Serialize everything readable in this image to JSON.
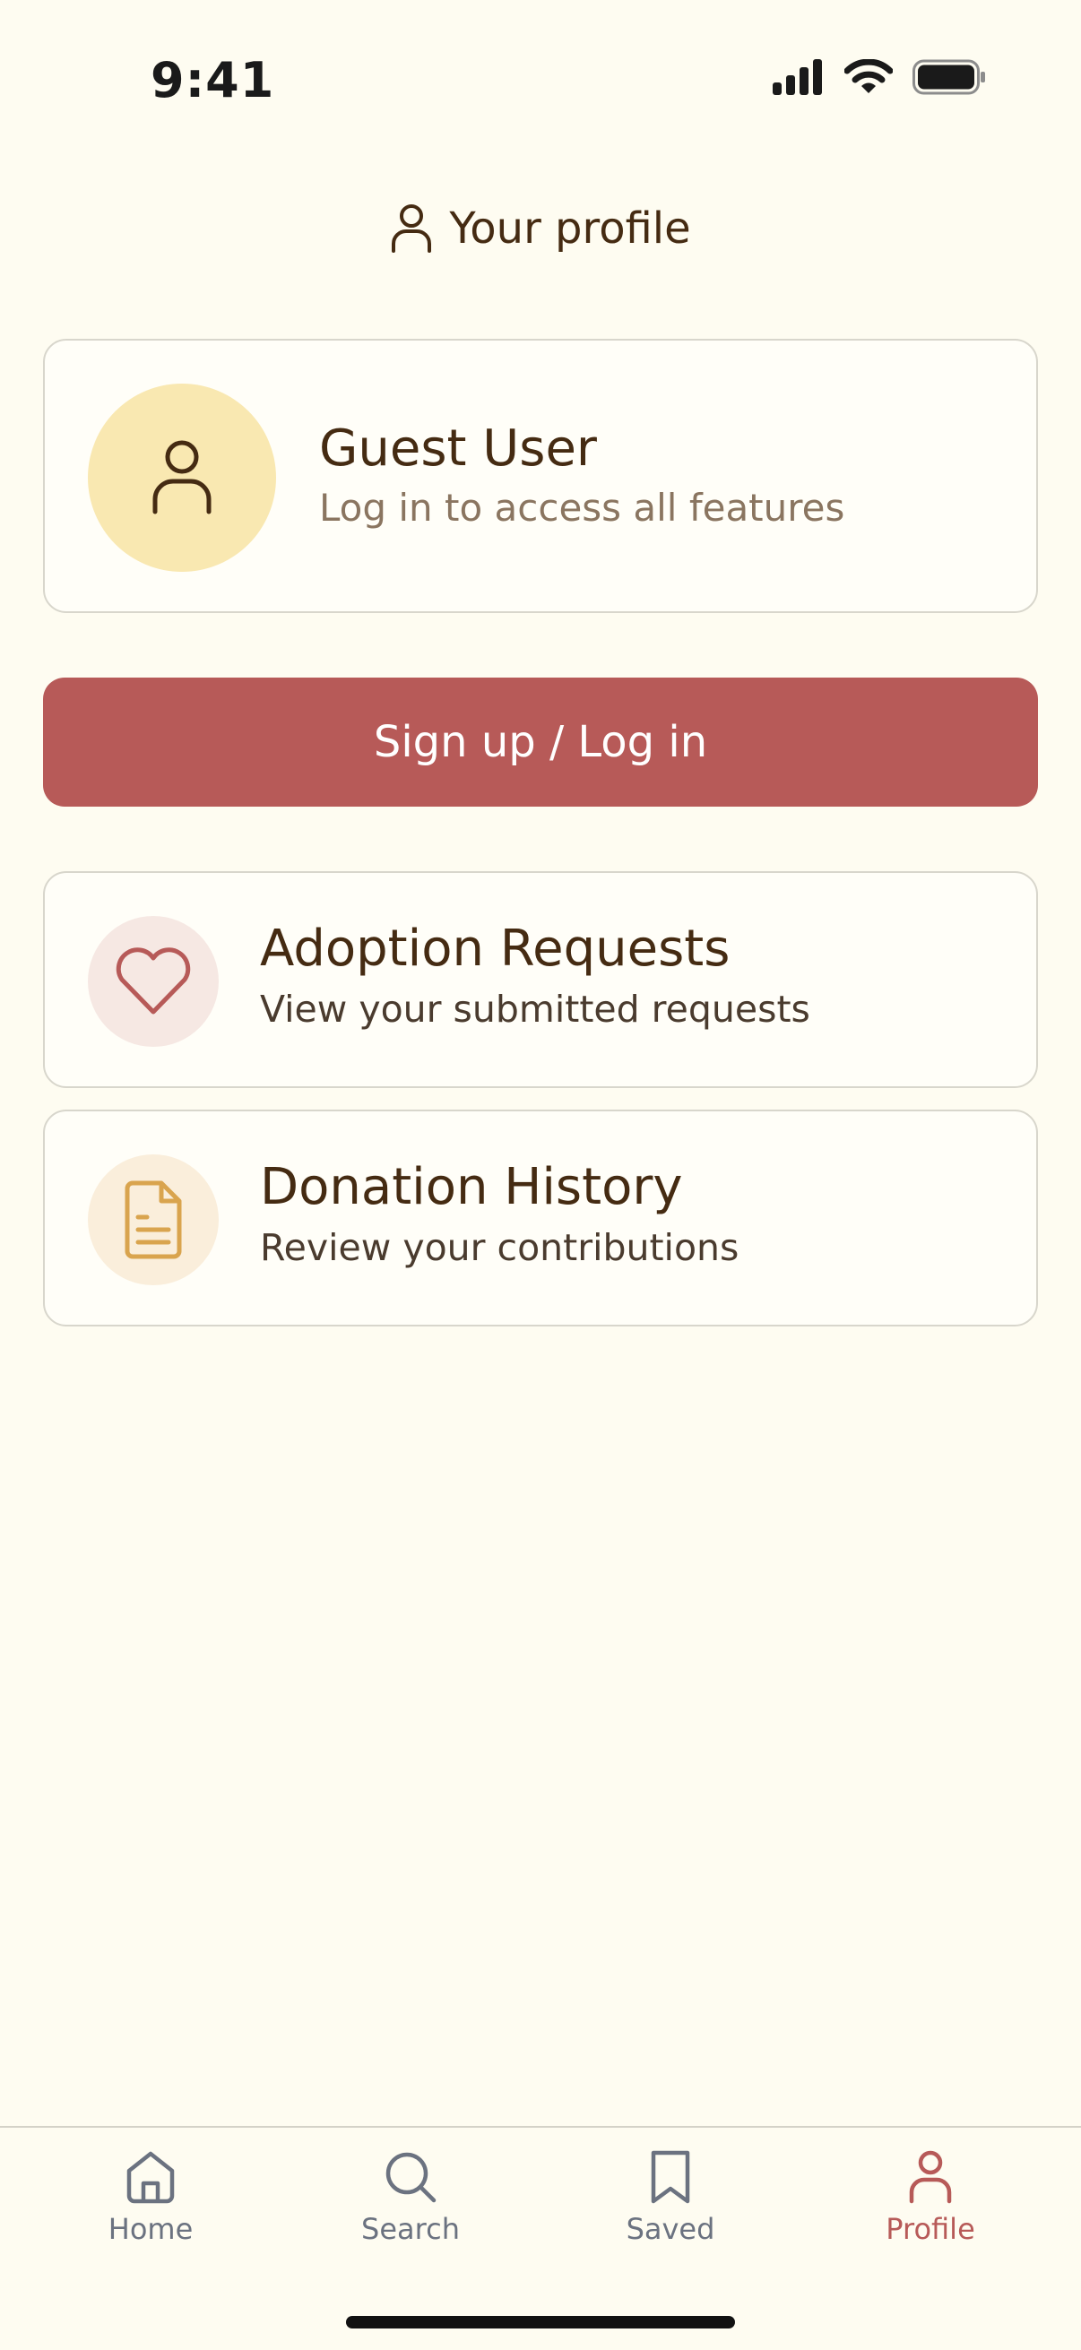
{
  "status_bar": {
    "time": "9:41"
  },
  "header": {
    "title": "Your profile",
    "icon": "user-icon"
  },
  "profile_card": {
    "name": "Guest User",
    "subtitle": "Log in to access all features",
    "avatar_icon": "user-icon"
  },
  "signin_button": {
    "label": "Sign up / Log in"
  },
  "menu": [
    {
      "title": "Adoption Requests",
      "subtitle": "View your submitted requests",
      "icon": "heart-icon"
    },
    {
      "title": "Donation History",
      "subtitle": "Review your contributions",
      "icon": "document-icon"
    }
  ],
  "tab_bar": {
    "tabs": [
      {
        "label": "Home",
        "icon": "home-icon"
      },
      {
        "label": "Search",
        "icon": "search-icon"
      },
      {
        "label": "Saved",
        "icon": "bookmark-icon"
      },
      {
        "label": "Profile",
        "icon": "user-icon"
      }
    ],
    "active": "Profile"
  },
  "colors": {
    "background": "#FEFCF1",
    "accent": "#B75A58",
    "text_primary": "#452B12",
    "avatar_bg": "#F9E8B1",
    "document_icon": "#D9A44E",
    "tab_inactive": "#6B7280"
  }
}
